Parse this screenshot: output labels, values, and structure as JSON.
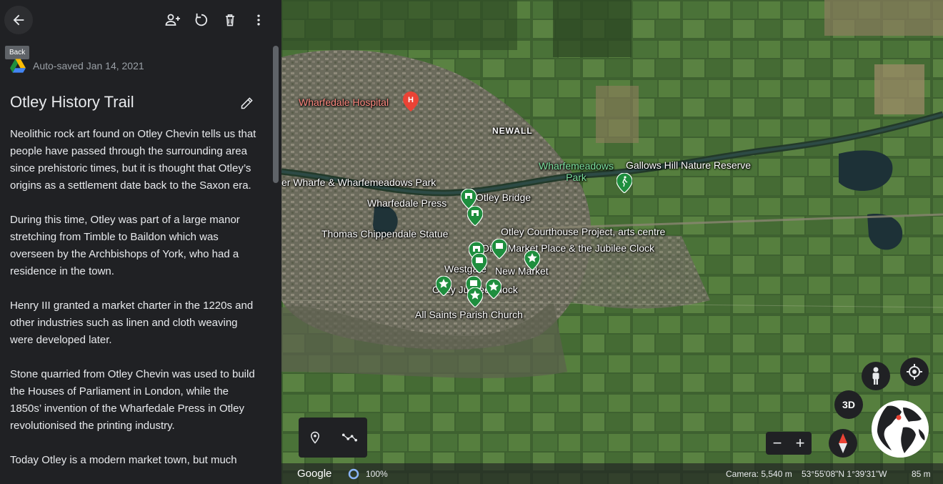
{
  "panel": {
    "back_tooltip": "Back",
    "autosave": "Auto-saved Jan 14, 2021",
    "title": "Otley History Trail",
    "paragraphs": [
      "Neolithic rock art found on Otley Chevin tells us that people have passed through the surrounding area since prehistoric times, but it is thought that Otley’s origins as a settlement date back to the Saxon era.",
      "During this time, Otley was part of a large manor stretching from Timble to Baildon which was overseen by the Archbishops of York, who had a residence in the town.",
      "Henry III granted a market charter in the 1220s and other industries such as linen and cloth weaving were developed later.",
      "Stone quarried from Otley Chevin was used to build the Houses of Parliament in London, while the 1850s’ invention of the Wharfedale Press in Otley revolutionised the printing industry.",
      "Today Otley is a modern market town, but much"
    ],
    "icons": {
      "back": "arrow-back-icon",
      "share": "add-person-icon",
      "refresh": "refresh-icon",
      "delete": "trash-icon",
      "more": "more-vert-icon",
      "drive": "google-drive-icon",
      "edit": "pencil-icon"
    }
  },
  "map": {
    "labels": {
      "hospital": "Wharfedale Hospital",
      "newall": "NEWALL",
      "wharfemeadows_park": "Wharfemeadows\nPark",
      "gallows_hill": "Gallows Hill Nature Reserve",
      "river_wharfe": "er Wharfe & Wharfemeadows Park",
      "otley_bridge": "Otley Bridge",
      "wharfedale_press": "Wharfedale Press",
      "chippendale": "Thomas Chippendale Statue",
      "courthouse": "Otley Courthouse Project, arts centre",
      "market_place": "Otley Market Place & the Jubilee Clock",
      "westgate": "Westgate",
      "new_market": "New Market",
      "jubilee_clock": "Otley Jubilee Clock",
      "all_saints": "All Saints Parish Church"
    },
    "controls": {
      "btn_3d": "3D",
      "zoom_out": "−",
      "zoom_in": "+"
    },
    "status": {
      "logo": "Google",
      "loading": "100%",
      "camera": "Camera: 5,540 m",
      "coords": "53°55'08\"N 1°39'31\"W",
      "scale": "85 m"
    },
    "colors": {
      "pin_green": "#1e8e3e",
      "pin_red": "#ea4335",
      "accent_blue": "#8ab4f8"
    }
  }
}
